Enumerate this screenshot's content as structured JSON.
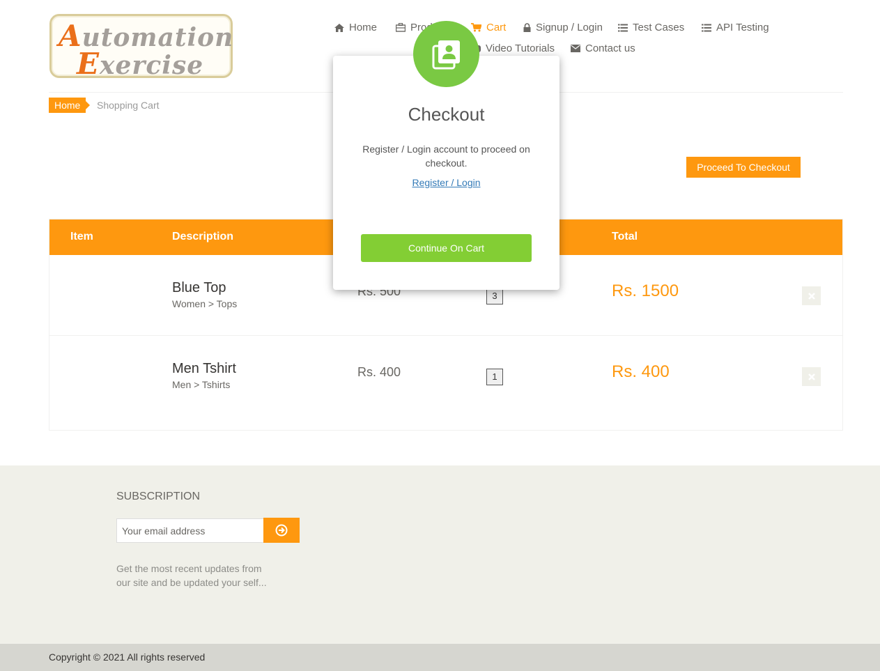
{
  "logo": {
    "line1_cap": "A",
    "line1_rest": "utomation",
    "line2_cap": "E",
    "line2_rest": "xercise"
  },
  "nav": {
    "home": "Home",
    "products": "Products",
    "cart": "Cart",
    "signup_login": "Signup / Login",
    "test_cases": "Test Cases",
    "api_testing": "API Testing",
    "video_tutorials": "Video Tutorials",
    "contact_us": "Contact us",
    "active_item": "Cart"
  },
  "breadcrumb": {
    "home": "Home",
    "current": "Shopping Cart"
  },
  "proceed_button": "Proceed To Checkout",
  "cart": {
    "headers": {
      "item": "Item",
      "description": "Description",
      "total": "Total"
    },
    "items": [
      {
        "name": "Blue Top",
        "category": "Women > Tops",
        "price": "Rs. 500",
        "quantity": "3",
        "total": "Rs. 1500"
      },
      {
        "name": "Men Tshirt",
        "category": "Men > Tshirts",
        "price": "Rs. 400",
        "quantity": "1",
        "total": "Rs. 400"
      }
    ]
  },
  "subscription": {
    "title": "SUBSCRIPTION",
    "placeholder": "Your email address",
    "description": "Get the most recent updates from our site and be updated your self..."
  },
  "copyright": "Copyright © 2021 All rights reserved",
  "modal": {
    "title": "Checkout",
    "message": "Register / Login account to proceed on checkout.",
    "link": "Register / Login",
    "continue_button": "Continue On Cart",
    "icon": "contacts-icon"
  },
  "colors": {
    "accent": "#FE980F",
    "modal_green": "#83CE34",
    "link_blue": "#337AB7",
    "footer_bg": "#F0F0E9"
  }
}
